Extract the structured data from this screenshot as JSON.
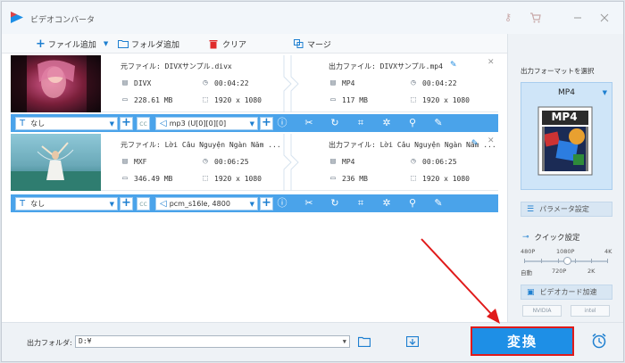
{
  "app": {
    "title": "ビデオコンバータ",
    "accent": "#1e8fe6"
  },
  "toolbar": {
    "add_file": "ファイル追加",
    "add_folder": "フォルダ追加",
    "clear": "クリア",
    "merge": "マージ"
  },
  "items": [
    {
      "source_label": "元ファイル: DIVXサンプル.divx",
      "source_format": "DIVX",
      "source_duration": "00:04:22",
      "source_size": "228.61 MB",
      "source_resolution": "1920 x 1080",
      "output_label": "出力ファイル: DIVXサンプル.mp4",
      "output_format": "MP4",
      "output_duration": "00:04:22",
      "output_size": "117 MB",
      "output_resolution": "1920 x 1080",
      "subtitle": "なし",
      "audio": "mp3 (U[0][0][0]"
    },
    {
      "source_label": "元ファイル: Lời Câu Nguyện Ngàn Năm ...",
      "source_format": "MXF",
      "source_duration": "00:06:25",
      "source_size": "346.49 MB",
      "source_resolution": "1920 x 1080",
      "output_label": "出力ファイル: Lời Câu Nguyện Ngàn Năm ...",
      "output_format": "MP4",
      "output_duration": "00:06:25",
      "output_size": "236 MB",
      "output_resolution": "1920 x 1080",
      "subtitle": "なし",
      "audio": "pcm_s16le, 4800"
    }
  ],
  "right_panel": {
    "select_format_title": "出力フォーマットを選択",
    "selected_format": "MP4",
    "thumbnail_label": "MP4",
    "params_button": "パラメータ設定",
    "quick_settings": "クイック設定",
    "quality_top": [
      "480P",
      "1080P",
      "4K"
    ],
    "quality_bottom": [
      "自動",
      "720P",
      "2K"
    ],
    "gpu_accel": "ビデオカード加速",
    "gpu_nvidia": "NVIDIA",
    "gpu_intel": "intel"
  },
  "bottom": {
    "output_folder_label": "出力フォルダ:",
    "output_folder_value": "D:¥",
    "convert_button": "変換"
  }
}
